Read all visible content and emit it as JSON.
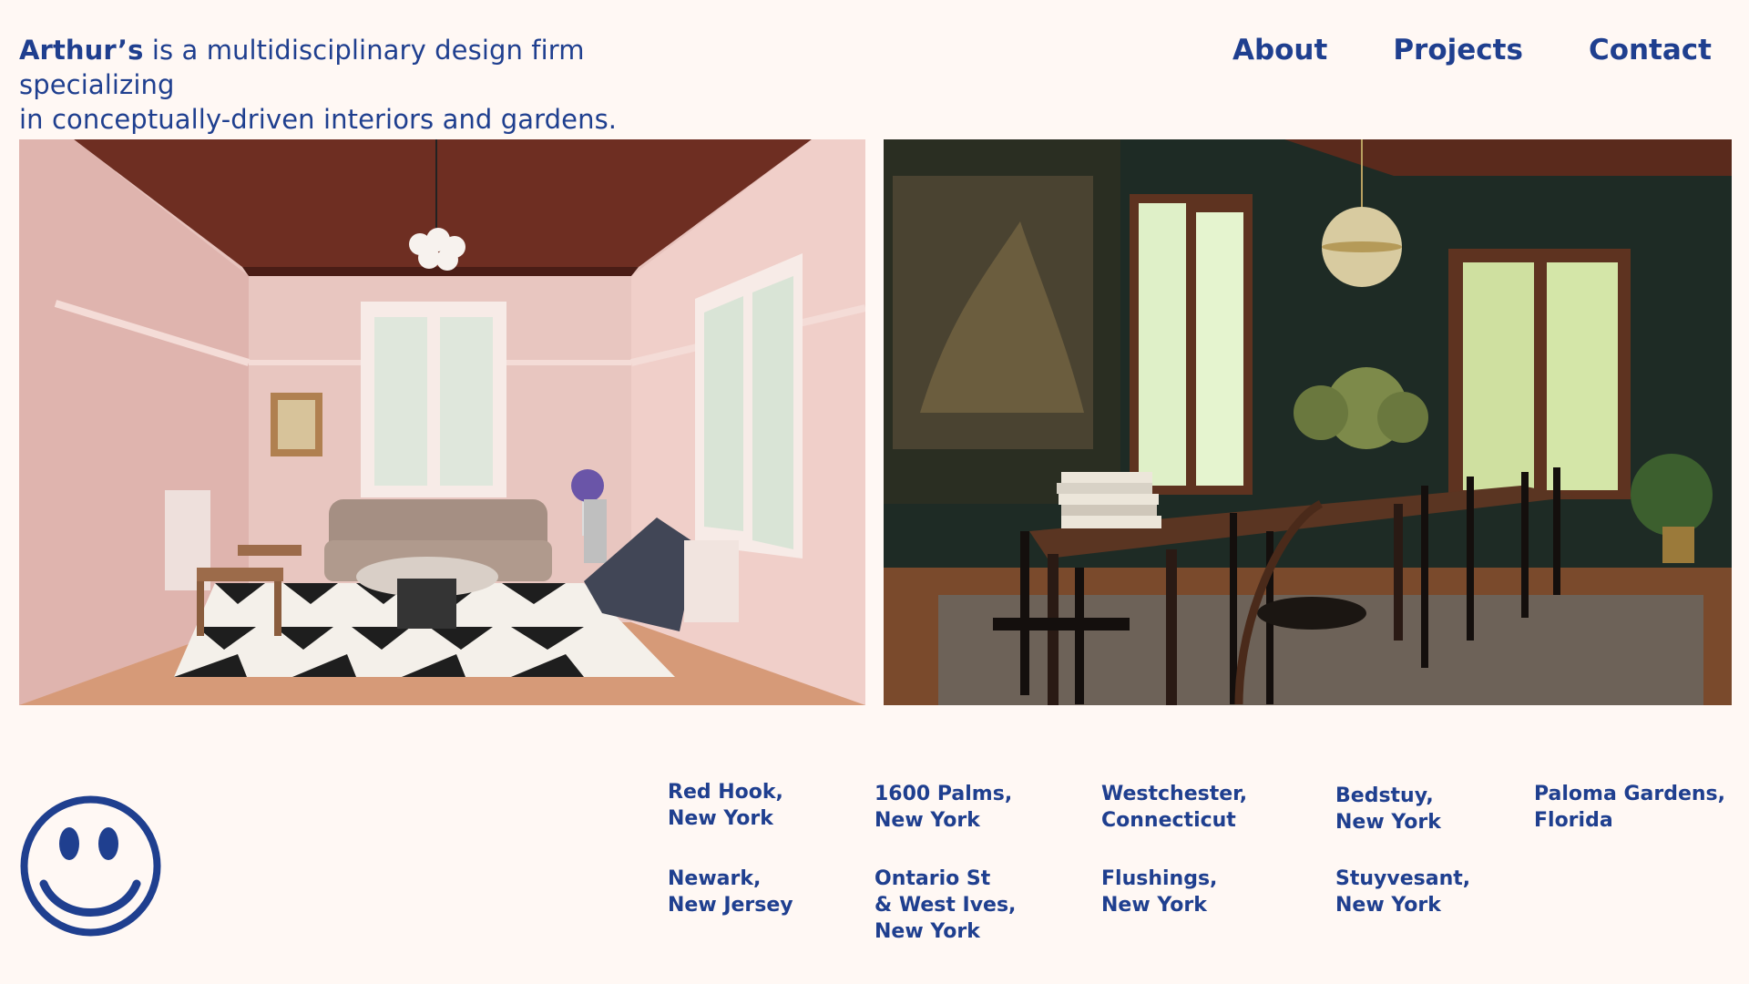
{
  "intro": {
    "brand": "Arthur’s",
    "text_rest": " is a multidisciplinary design firm specializing",
    "text_line2": "in conceptually-driven interiors and gardens."
  },
  "nav": {
    "about": "About",
    "projects": "Projects",
    "contact": "Contact"
  },
  "colors": {
    "background": "#fff8f4",
    "accent": "#1f3f8f"
  },
  "icons": {
    "logo": "smiley-face-icon"
  },
  "locations": [
    {
      "line1": "Red Hook,",
      "line2": "New York"
    },
    {
      "line1": "1600 Palms,",
      "line2": "New York"
    },
    {
      "line1": "Westchester,",
      "line2": "Connecticut"
    },
    {
      "line1": "Bedstuy,",
      "line2": "New York"
    },
    {
      "line1": "Paloma Gardens,",
      "line2": "Florida"
    },
    {
      "line1": "Newark,",
      "line2": "New Jersey"
    },
    {
      "line1": "Ontario St",
      "line2": "& West Ives,",
      "line3": "New York"
    },
    {
      "line1": "Flushings,",
      "line2": "New York"
    },
    {
      "line1": "Stuyvesant,",
      "line2": "New York"
    }
  ]
}
